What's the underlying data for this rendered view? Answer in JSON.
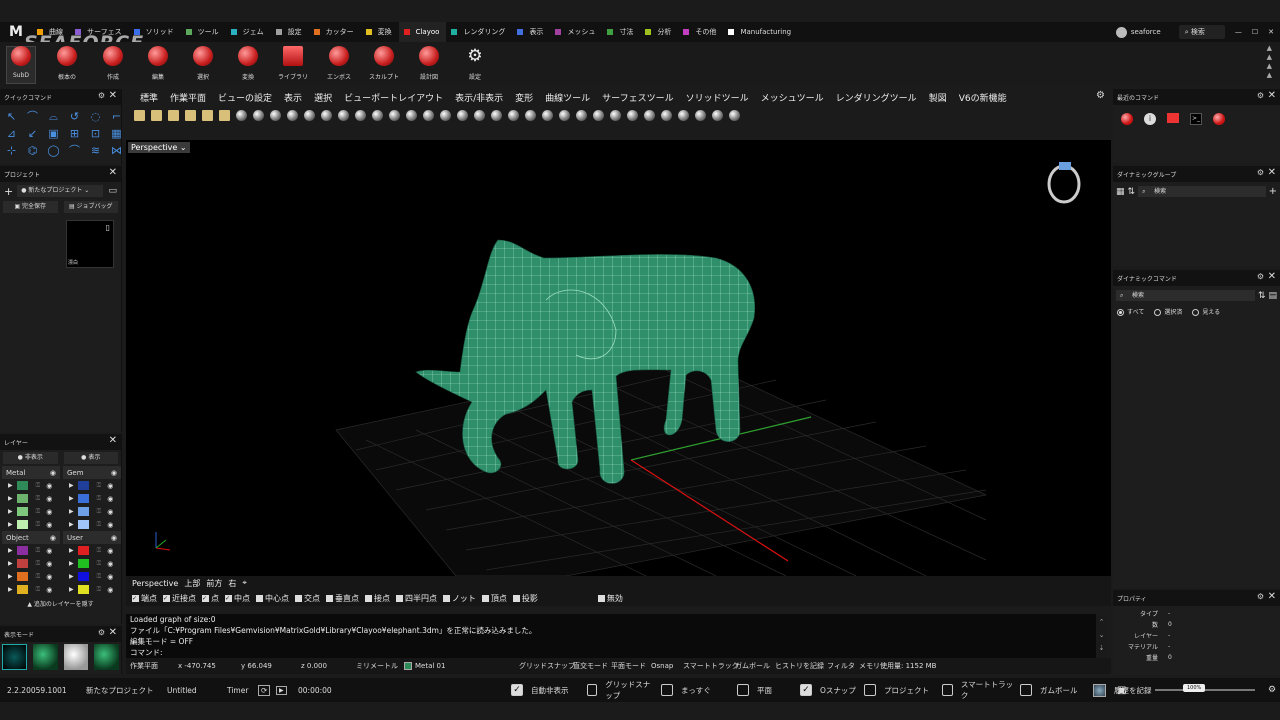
{
  "app": {
    "logo": "M",
    "watermark": "SEAFORCE"
  },
  "tabs": [
    {
      "label": "曲線",
      "color": "#f0a000"
    },
    {
      "label": "サーフェス",
      "color": "#8a5cd0"
    },
    {
      "label": "ソリッド",
      "color": "#3a6ee8"
    },
    {
      "label": "ツール",
      "color": "#5ca85c"
    },
    {
      "label": "ジェム",
      "color": "#2ab0c0"
    },
    {
      "label": "設定",
      "color": "#a0a0a0"
    },
    {
      "label": "カッター",
      "color": "#e07020"
    },
    {
      "label": "変換",
      "color": "#e0c020"
    },
    {
      "label": "Clayoo",
      "color": "#e02020"
    },
    {
      "label": "レンダリング",
      "color": "#20b0a0"
    },
    {
      "label": "表示",
      "color": "#4070e0"
    },
    {
      "label": "メッシュ",
      "color": "#a040a0"
    },
    {
      "label": "寸法",
      "color": "#40a040"
    },
    {
      "label": "分析",
      "color": "#a0c020"
    },
    {
      "label": "その他",
      "color": "#c040c0"
    },
    {
      "label": "Manufacturing",
      "color": "#ffffff"
    }
  ],
  "user": {
    "name": "seaforce",
    "search": "検索"
  },
  "ribbon": [
    {
      "label": "SubD"
    },
    {
      "label": "根本の"
    },
    {
      "label": "作成"
    },
    {
      "label": "編集"
    },
    {
      "label": "選択"
    },
    {
      "label": "変換"
    },
    {
      "label": "ライブラリ"
    },
    {
      "label": "エンボス"
    },
    {
      "label": "スカルプト"
    },
    {
      "label": "設計図"
    },
    {
      "label": "設定"
    }
  ],
  "quick": {
    "title": "クイックコマンド"
  },
  "project": {
    "title": "プロジェクト",
    "new_project": "新たなプロジェクト",
    "save_all": "完全保存",
    "job_bag": "ジョブバッグ",
    "thumb_label": "漂白"
  },
  "layers": {
    "title": "レイヤー",
    "hide": "非表示",
    "show": "表示",
    "add": "追加のレイヤーを隠す",
    "groups": [
      {
        "name": "Metal",
        "colors": [
          "#2e8b57",
          "#6db36d",
          "#7ec87e",
          "#c0f0b0"
        ]
      },
      {
        "name": "Gem",
        "colors": [
          "#1f3f9a",
          "#3a6ed8",
          "#6ea0e8",
          "#a0c4f8"
        ]
      },
      {
        "name": "Object",
        "colors": [
          "#8a2ea0",
          "#c04040",
          "#e07020",
          "#e0b020"
        ]
      },
      {
        "name": "User",
        "colors": [
          "#e02020",
          "#20c020",
          "#1010e0",
          "#e0e020"
        ]
      }
    ]
  },
  "mode": {
    "title": "表示モード"
  },
  "menu": [
    "標準",
    "作業平面",
    "ビューの設定",
    "表示",
    "選択",
    "ビューポートレイアウト",
    "表示/非表示",
    "変形",
    "曲線ツール",
    "サーフェスツール",
    "ソリッドツール",
    "メッシュツール",
    "レンダリングツール",
    "製図",
    "V6の新機能"
  ],
  "viewport": {
    "label": "Perspective",
    "tabs": [
      "Perspective",
      "上部",
      "前方",
      "右"
    ]
  },
  "osnap": [
    {
      "label": "端点",
      "on": true
    },
    {
      "label": "近接点",
      "on": true
    },
    {
      "label": "点",
      "on": true
    },
    {
      "label": "中点",
      "on": true
    },
    {
      "label": "中心点",
      "on": false
    },
    {
      "label": "交点",
      "on": false
    },
    {
      "label": "垂直点",
      "on": false
    },
    {
      "label": "接点",
      "on": false
    },
    {
      "label": "四半円点",
      "on": false
    },
    {
      "label": "ノット",
      "on": false
    },
    {
      "label": "頂点",
      "on": false
    },
    {
      "label": "投影",
      "on": false
    },
    {
      "label": "無効",
      "on": false
    }
  ],
  "log": [
    "Loaded graph of size:0",
    "ファイル「C:¥Program Files¥Gemvision¥MatrixGold¥Library¥Clayoo¥elephant.3dm」を正常に読み込みました。",
    "編集モード = OFF",
    "コマンド:"
  ],
  "status": {
    "plane": "作業平面",
    "x": "x -470.745",
    "y": "y 66.049",
    "z": "z 0.000",
    "unit": "ミリメートル",
    "layer": "Metal 01",
    "items": [
      "グリッドスナップ",
      "直交モード",
      "平面モード",
      "Osnap",
      "スマートトラック",
      "ガムボール",
      "ヒストリを記録",
      "フィルタ",
      "メモリ使用量: 1152 MB"
    ]
  },
  "bottom": {
    "version": "2.2.20059.1001",
    "project": "新たなプロジェクト",
    "file": "Untitled",
    "timer": "Timer",
    "time": "00:00:00",
    "toggles": [
      {
        "label": "自動非表示",
        "on": true
      },
      {
        "label": "グリッドスナップ",
        "on": false
      },
      {
        "label": "まっすぐ",
        "on": false
      },
      {
        "label": "平面",
        "on": false
      },
      {
        "label": "Oスナップ",
        "on": true
      },
      {
        "label": "プロジェクト",
        "on": false
      },
      {
        "label": "スマートトラック",
        "on": false
      },
      {
        "label": "ガムボール",
        "on": false
      },
      {
        "label": "履歴を記録",
        "on": false
      }
    ],
    "zoom": "100%"
  },
  "recent": {
    "title": "最近のコマンド"
  },
  "dyngroup": {
    "title": "ダイナミックグループ",
    "search": "検索"
  },
  "dyncmd": {
    "title": "ダイナミックコマンド",
    "search": "検索",
    "options": [
      "すべて",
      "選択済",
      "見える"
    ]
  },
  "props": {
    "title": "プロパティ",
    "rows": [
      {
        "k": "タイプ",
        "v": "-"
      },
      {
        "k": "数",
        "v": "0"
      },
      {
        "k": "レイヤー",
        "v": "-"
      },
      {
        "k": "マテリアル",
        "v": "-"
      },
      {
        "k": "重量",
        "v": "0"
      }
    ]
  }
}
